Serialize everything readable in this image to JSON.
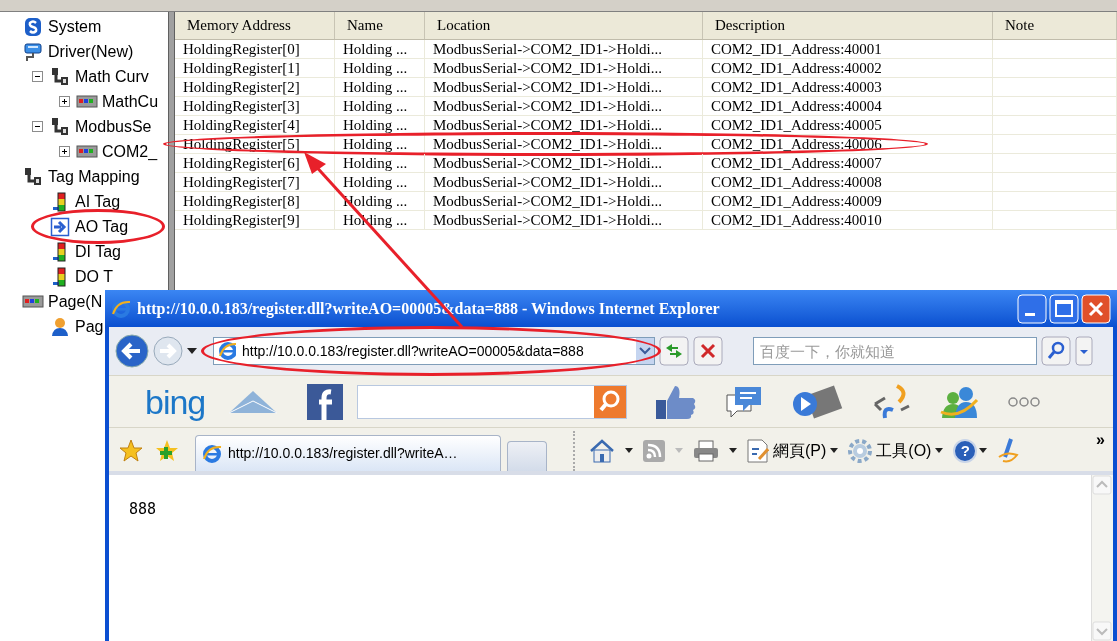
{
  "tree": [
    {
      "label": "System",
      "kind": "system",
      "circled": false
    },
    {
      "label": "Driver(New)",
      "kind": "driver",
      "circled": false,
      "children": [
        {
          "label": "Math Curv",
          "kind": "group",
          "expanded": true,
          "circled": false,
          "children": [
            {
              "label": "MathCu",
              "kind": "device",
              "expanded": false,
              "circled": false
            }
          ]
        },
        {
          "label": "ModbusSe",
          "kind": "group",
          "expanded": true,
          "circled": false,
          "children": [
            {
              "label": "COM2_",
              "kind": "device",
              "expanded": false,
              "circled": false
            }
          ]
        }
      ]
    },
    {
      "label": "Tag Mapping",
      "kind": "group",
      "circled": false,
      "children": [
        {
          "label": "AI Tag",
          "kind": "tag",
          "circled": false
        },
        {
          "label": "AO Tag",
          "kind": "ao-tag",
          "circled": true
        },
        {
          "label": "DI Tag",
          "kind": "tag",
          "circled": false
        },
        {
          "label": "DO T",
          "kind": "tag",
          "circled": false
        }
      ]
    },
    {
      "label": "Page(N",
      "kind": "device",
      "circled": false,
      "children": [
        {
          "label": "Pag",
          "kind": "user",
          "circled": false
        }
      ]
    }
  ],
  "table": {
    "columns": [
      "Memory Address",
      "Name",
      "Location",
      "Description",
      "Note"
    ],
    "rows": [
      {
        "cells": [
          "HoldingRegister[0]",
          "Holding ...",
          "ModbusSerial->COM2_ID1->Holdi...",
          "COM2_ID1_Address:40001"
        ],
        "circled": false
      },
      {
        "cells": [
          "HoldingRegister[1]",
          "Holding ...",
          "ModbusSerial->COM2_ID1->Holdi...",
          "COM2_ID1_Address:40002"
        ],
        "circled": false
      },
      {
        "cells": [
          "HoldingRegister[2]",
          "Holding ...",
          "ModbusSerial->COM2_ID1->Holdi...",
          "COM2_ID1_Address:40003"
        ],
        "circled": false
      },
      {
        "cells": [
          "HoldingRegister[3]",
          "Holding ...",
          "ModbusSerial->COM2_ID1->Holdi...",
          "COM2_ID1_Address:40004"
        ],
        "circled": false
      },
      {
        "cells": [
          "HoldingRegister[4]",
          "Holding ...",
          "ModbusSerial->COM2_ID1->Holdi...",
          "COM2_ID1_Address:40005"
        ],
        "circled": false
      },
      {
        "cells": [
          "HoldingRegister[5]",
          "Holding ...",
          "ModbusSerial->COM2_ID1->Holdi...",
          "COM2_ID1_Address:40006"
        ],
        "circled": true
      },
      {
        "cells": [
          "HoldingRegister[6]",
          "Holding ...",
          "ModbusSerial->COM2_ID1->Holdi...",
          "COM2_ID1_Address:40007"
        ],
        "circled": false
      },
      {
        "cells": [
          "HoldingRegister[7]",
          "Holding ...",
          "ModbusSerial->COM2_ID1->Holdi...",
          "COM2_ID1_Address:40008"
        ],
        "circled": false
      },
      {
        "cells": [
          "HoldingRegister[8]",
          "Holding ...",
          "ModbusSerial->COM2_ID1->Holdi...",
          "COM2_ID1_Address:40009"
        ],
        "circled": false
      },
      {
        "cells": [
          "HoldingRegister[9]",
          "Holding ...",
          "ModbusSerial->COM2_ID1->Holdi...",
          "COM2_ID1_Address:40010"
        ],
        "circled": false
      }
    ]
  },
  "browser": {
    "title": "http://10.0.0.183/register.dll?writeAO=00005&data=888 - Windows Internet Explorer",
    "address": {
      "value": "http://10.0.0.183/register.dll?writeAO=00005&data=888",
      "circled": true
    },
    "search": {
      "placeholder": "百度一下，你就知道"
    },
    "links_bar": {
      "logo": "bing"
    },
    "tabs": [
      {
        "kind": "page",
        "label": "http://10.0.0.183/register.dll?writeA…",
        "selected": true
      },
      {
        "kind": "new-tab",
        "selected": false
      }
    ],
    "command_bar": {
      "page_menu": "網頁(P)",
      "tools_menu": "工具(O)",
      "help": "?",
      "overflow": "»"
    },
    "content": "888"
  }
}
